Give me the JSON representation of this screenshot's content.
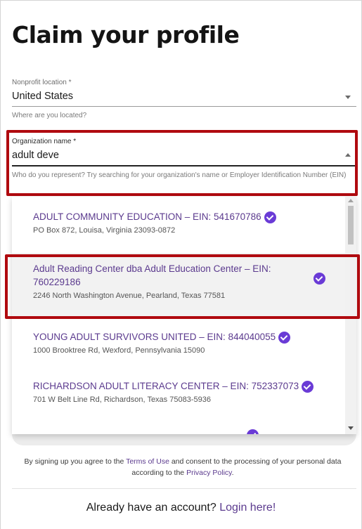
{
  "page": {
    "title": "Claim your profile"
  },
  "location_field": {
    "label": "Nonprofit location *",
    "value": "United States",
    "help": "Where are you located?"
  },
  "org_field": {
    "label": "Organization name *",
    "value": "adult deve",
    "help": "Who do you represent? Try searching for your organization's name or Employer Identification Number (EIN)"
  },
  "results": [
    {
      "title": "ADULT COMMUNITY EDUCATION – EIN: 541670786",
      "address": "PO Box 872, Louisa, Virginia 23093-0872",
      "verified": true
    },
    {
      "title": "Adult Reading Center dba Adult Education Center – EIN: 760229186",
      "address": "2246 North Washington Avenue, Pearland, Texas 77581",
      "verified": true,
      "selected": true
    },
    {
      "title": "YOUNG ADULT SURVIVORS UNITED – EIN: 844040055",
      "address": "1000 Brooktree Rd, Wexford, Pennsylvania 15090",
      "verified": true
    },
    {
      "title": "RICHARDSON ADULT LITERACY CENTER – EIN: 752337073",
      "address": "701 W Belt Line Rd, Richardson, Texas 75083-5936",
      "verified": true
    }
  ],
  "footer": {
    "terms_prefix": "By signing up you agree to the ",
    "terms_link": "Terms of Use",
    "terms_middle": " and consent to the processing of your personal data according to the ",
    "privacy_link": "Privacy Policy",
    "terms_suffix": ".",
    "login_prefix": "Already have an account? ",
    "login_link": "Login here!"
  },
  "colors": {
    "accent": "#5b3a8e",
    "check": "#6a3bd6",
    "highlight": "#b00a0f"
  }
}
